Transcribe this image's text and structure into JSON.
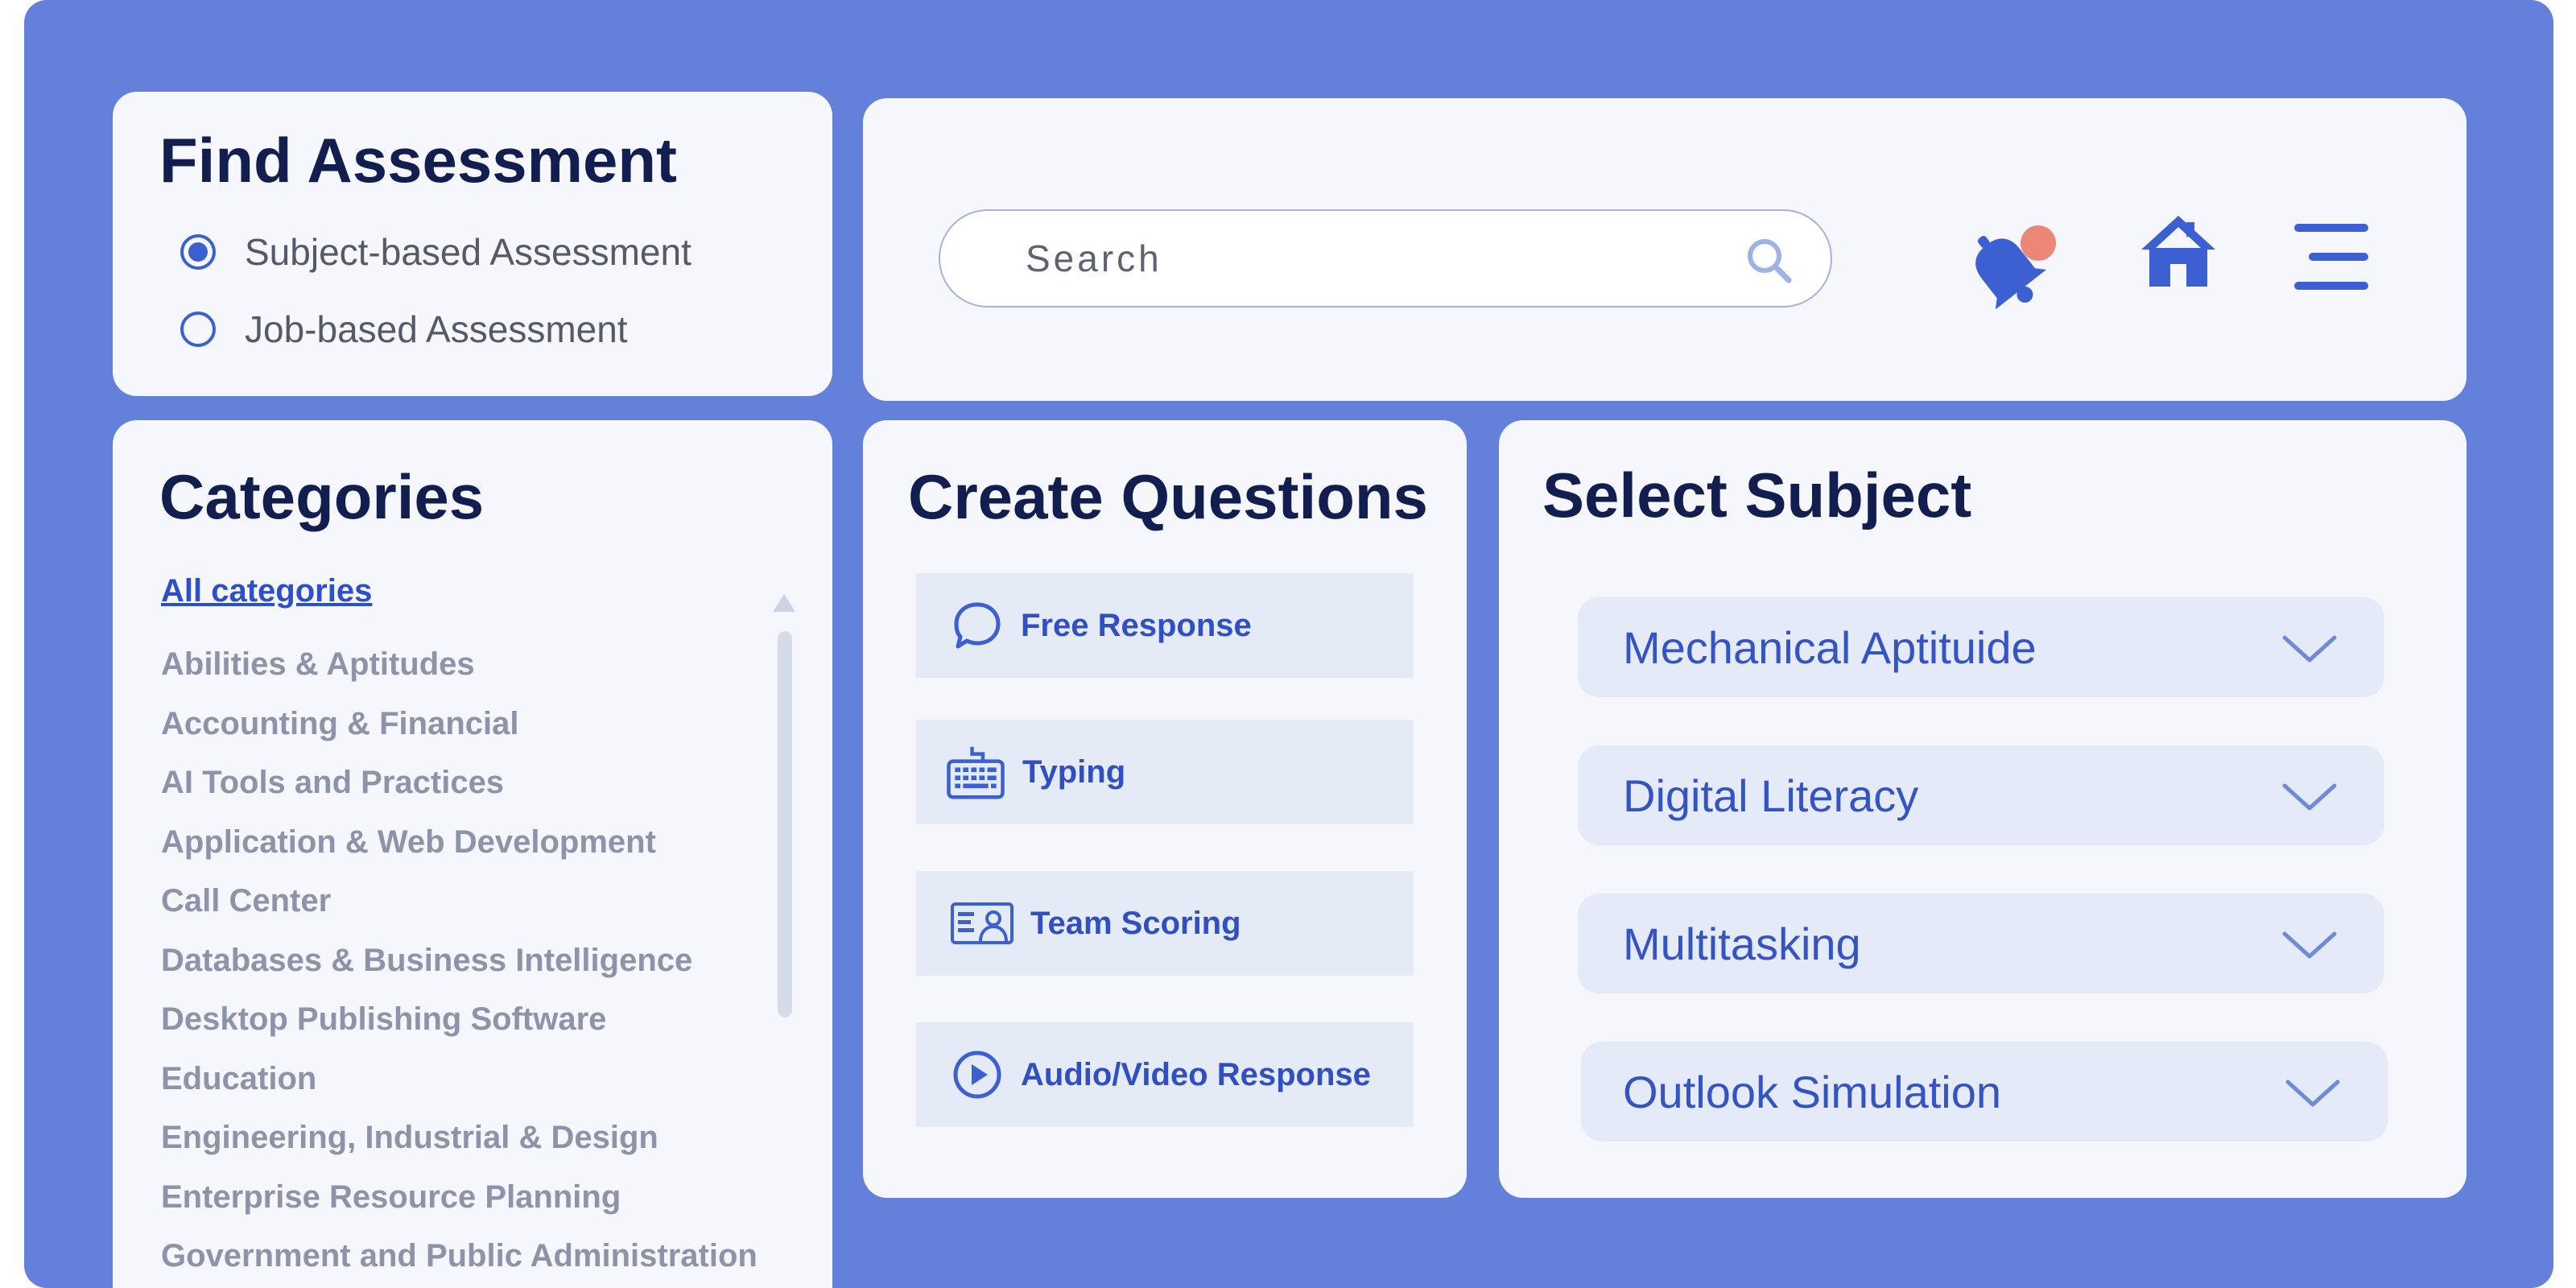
{
  "find_assessment": {
    "title": "Find Assessment",
    "options": [
      {
        "label": "Subject-based Assessment",
        "selected": true
      },
      {
        "label": "Job-based Assessment",
        "selected": false
      }
    ]
  },
  "header": {
    "search_placeholder": "Search",
    "icons": [
      "search-icon",
      "bell-icon",
      "home-icon",
      "menu-icon"
    ],
    "notification_dot_color": "#ec8676"
  },
  "categories": {
    "title": "Categories",
    "all_label": "All categories",
    "items": [
      "Abilities & Aptitudes",
      "Accounting & Financial",
      "AI Tools and Practices",
      "Application & Web Development",
      "Call Center",
      "Databases & Business Intelligence",
      "Desktop Publishing Software",
      "Education",
      "Engineering, Industrial & Design",
      "Enterprise Resource Planning",
      "Government and Public Administration"
    ]
  },
  "create_questions": {
    "title": "Create Questions",
    "items": [
      {
        "label": "Free Response",
        "icon": "speech-bubble-icon"
      },
      {
        "label": "Typing",
        "icon": "keyboard-icon"
      },
      {
        "label": "Team Scoring",
        "icon": "id-card-icon"
      },
      {
        "label": "Audio/Video Response",
        "icon": "play-icon"
      }
    ]
  },
  "select_subject": {
    "title": "Select Subject",
    "items": [
      {
        "label": "Mechanical Aptituide"
      },
      {
        "label": "Digital Literacy"
      },
      {
        "label": "Multitasking"
      },
      {
        "label": "Outlook Simulation"
      }
    ]
  },
  "colors": {
    "background": "#6381db",
    "card": "#f5f7fc",
    "accent": "#3c5fd2",
    "heading": "#121e4f"
  }
}
